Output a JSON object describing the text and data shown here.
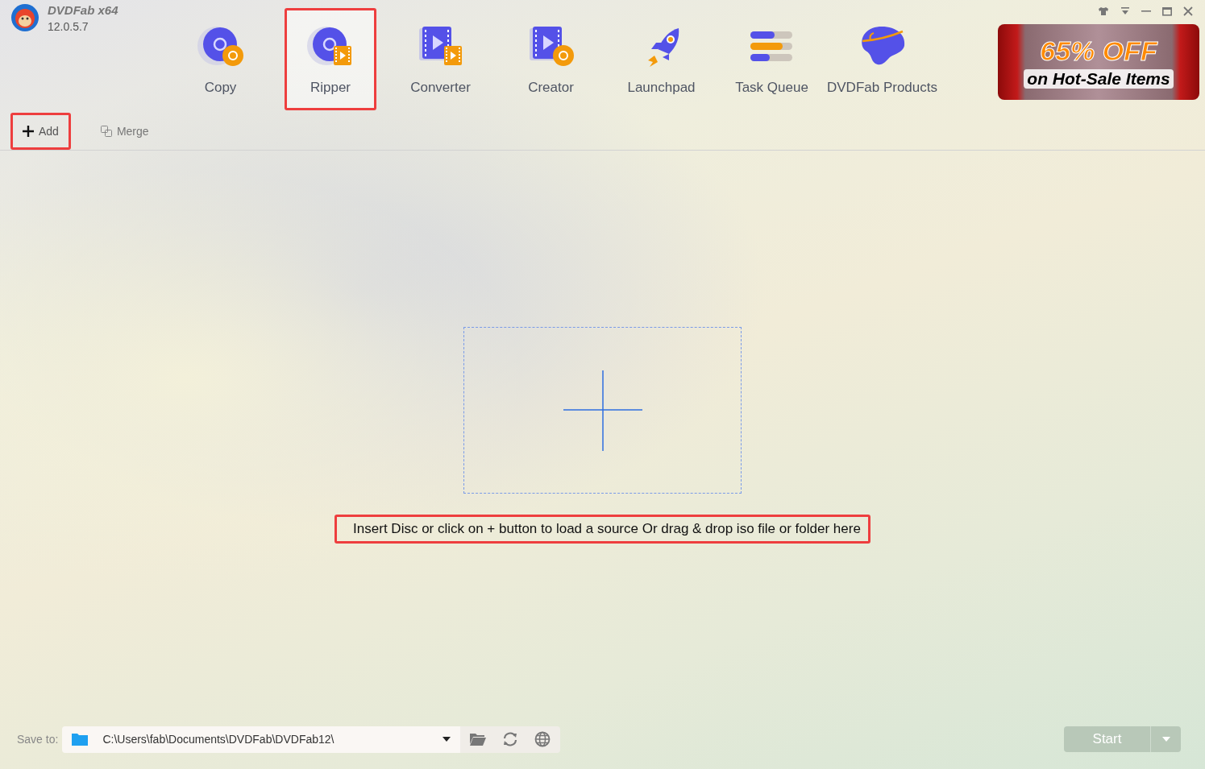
{
  "app": {
    "name": "DVDFab x64",
    "version": "12.0.5.7"
  },
  "nav": [
    {
      "label": "Copy",
      "kind": "disc-disc",
      "selected": false,
      "highlighted": false
    },
    {
      "label": "Ripper",
      "kind": "disc-film",
      "selected": true,
      "highlighted": true
    },
    {
      "label": "Converter",
      "kind": "film-film",
      "selected": false,
      "highlighted": false
    },
    {
      "label": "Creator",
      "kind": "film-disc",
      "selected": false,
      "highlighted": false
    },
    {
      "label": "Launchpad",
      "kind": "rocket",
      "selected": false,
      "highlighted": false
    },
    {
      "label": "Task Queue",
      "kind": "queue",
      "selected": false,
      "highlighted": false
    },
    {
      "label": "DVDFab Products",
      "kind": "head",
      "selected": false,
      "highlighted": false
    }
  ],
  "promo": {
    "headline": "65% OFF",
    "subline": "on Hot-Sale Items"
  },
  "toolbar": [
    {
      "label": "Add",
      "kind": "add",
      "highlighted": true,
      "disabled": false
    },
    {
      "label": "Merge",
      "kind": "merge",
      "highlighted": false,
      "disabled": true
    }
  ],
  "drop_zone": {
    "hint": "Insert Disc or click on + button to load a source Or drag & drop iso file or folder here",
    "hint_highlighted": true
  },
  "footer": {
    "save_label": "Save to:",
    "path": "C:\\Users\\fab\\Documents\\DVDFab\\DVDFab12\\",
    "start": "Start",
    "start_disabled": true
  }
}
